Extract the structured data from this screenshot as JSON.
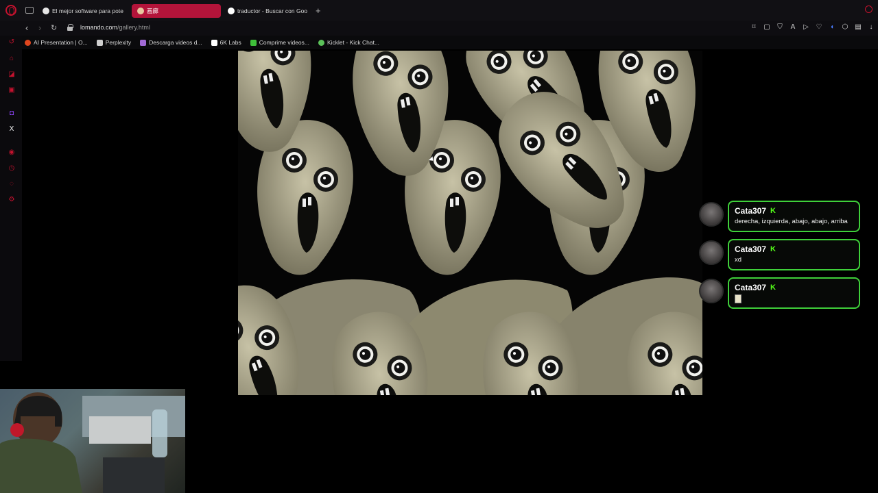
{
  "tabs": [
    {
      "label": "El mejor software para pote",
      "fav_color": "#e6e6e6"
    },
    {
      "label": "画廊",
      "fav_color": "#e8c8a0"
    },
    {
      "label": "traductor - Buscar con Goo",
      "fav_color": "#ffffff"
    }
  ],
  "address": {
    "domain": "lomando.com",
    "path": "/gallery.html"
  },
  "bookmarks": [
    {
      "label": "AI Presentation | O...",
      "color": "#e0461e"
    },
    {
      "label": "Perplexity",
      "color": "#cfcfcf"
    },
    {
      "label": "Descarga videos d...",
      "color": "#a26ad6"
    },
    {
      "label": "6K Labs",
      "color": "#ffffff"
    },
    {
      "label": "Comprime videos...",
      "color": "#3fbf3a"
    },
    {
      "label": "Kicklet - Kick Chat...",
      "color": "#5cc25a"
    }
  ],
  "chat": {
    "messages": [
      {
        "user": "Cata307",
        "text": "derecha, izquierda, abajo, abajo, arriba",
        "type": "text"
      },
      {
        "user": "Cata307",
        "text": "xd",
        "type": "text"
      },
      {
        "user": "Cata307",
        "text": "",
        "type": "emote"
      }
    ],
    "badge_color": "#53fc18",
    "border_color": "#3fd13a"
  },
  "icons": {
    "kick_badge": "K"
  }
}
